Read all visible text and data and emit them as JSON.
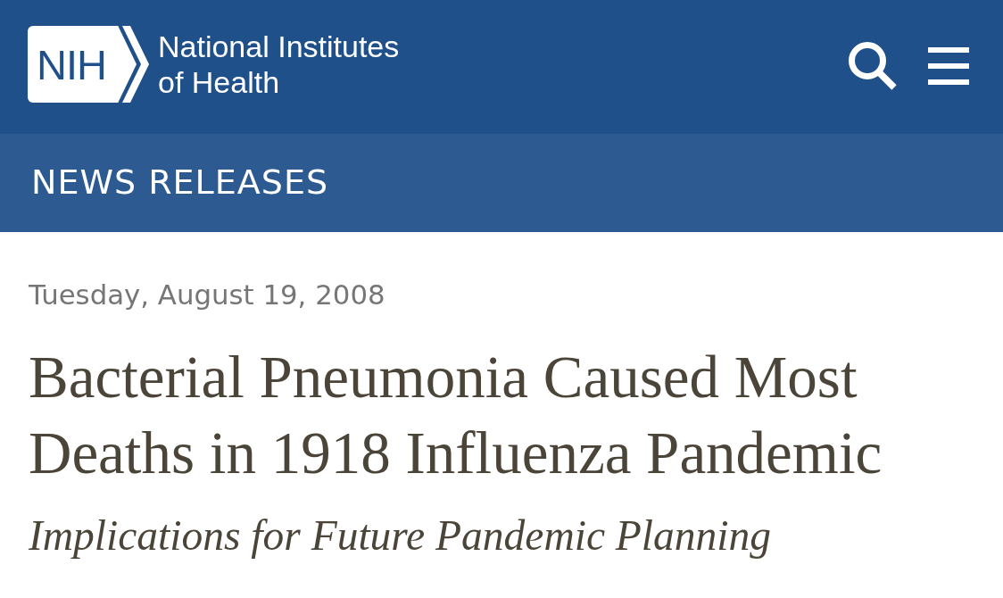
{
  "header": {
    "logo": {
      "mark": "NIH",
      "name": "National Institutes of Health"
    }
  },
  "section_bar": {
    "title": "NEWS RELEASES"
  },
  "article": {
    "date": "Tuesday, August 19, 2008",
    "title": "Bacterial Pneumonia Caused Most Deaths in 1918 Influenza Pandemic",
    "subtitle": "Implications for Future Pandemic Planning"
  }
}
